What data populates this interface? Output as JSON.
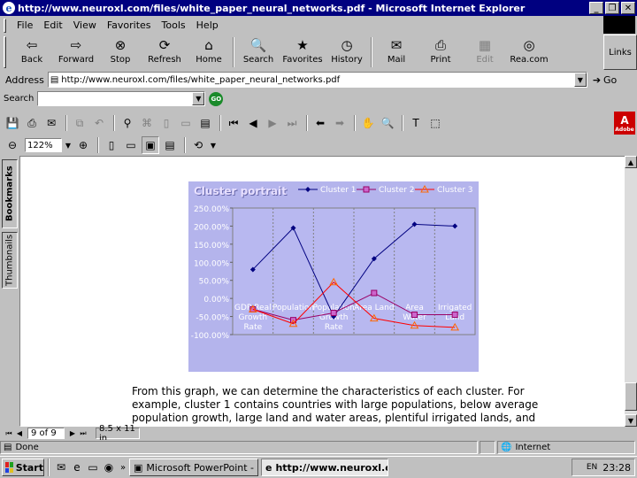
{
  "window": {
    "title": "http://www.neuroxl.com/files/white_paper_neural_networks.pdf - Microsoft Internet Explorer"
  },
  "menu": [
    "File",
    "Edit",
    "View",
    "Favorites",
    "Tools",
    "Help"
  ],
  "toolbar": {
    "back": "Back",
    "forward": "Forward",
    "stop": "Stop",
    "refresh": "Refresh",
    "home": "Home",
    "search": "Search",
    "favorites": "Favorites",
    "history": "History",
    "mail": "Mail",
    "print": "Print",
    "edit": "Edit",
    "realcom": "Rea.com",
    "links": "Links"
  },
  "address": {
    "label": "Address",
    "url": "http://www.neuroxl.com/files/white_paper_neural_networks.pdf",
    "go": "Go"
  },
  "searchbar": {
    "label": "Search",
    "go_icon": "GO"
  },
  "acrobat": {
    "zoom": "122%",
    "logo": "Adobe"
  },
  "nav_tabs": {
    "bookmarks": "Bookmarks",
    "thumbnails": "Thumbnails"
  },
  "pdf": {
    "body_text": "From this graph, we can determine the characteristics of each cluster. For example, cluster 1 contains countries with large populations, below average population growth, large land and water areas, plentiful irrigated lands, and"
  },
  "chart_data": {
    "type": "line",
    "title": "Cluster portrait",
    "categories": [
      "GDP Real Growth Rate",
      "Population",
      "Population Growth Rate",
      "Area Land",
      "Area Water",
      "Irrigated Land"
    ],
    "category_labels": [
      [
        "GDP Real",
        "Growth",
        "Rate"
      ],
      [
        "Population"
      ],
      [
        "Population",
        "Growth",
        "Rate"
      ],
      [
        "Area Land"
      ],
      [
        "Area",
        "Water"
      ],
      [
        "Irrigated",
        "Land"
      ]
    ],
    "series": [
      {
        "name": "Cluster 1",
        "color": "#000080",
        "marker": "diamond",
        "values": [
          80,
          195,
          -50,
          110,
          205,
          200
        ]
      },
      {
        "name": "Cluster 2",
        "color": "#990066",
        "marker": "square",
        "values": [
          -30,
          -60,
          -40,
          15,
          -45,
          -45
        ]
      },
      {
        "name": "Cluster 3",
        "color": "#ff0000",
        "marker": "triangle",
        "values": [
          -30,
          -70,
          45,
          -55,
          -75,
          -80
        ]
      }
    ],
    "ylim": [
      -100,
      250
    ],
    "yticks": [
      "250.00%",
      "200.00%",
      "150.00%",
      "100.00%",
      "50.00%",
      "0.00%",
      "-50.00%",
      "-100.00%"
    ],
    "legend_position": "top",
    "grid": true
  },
  "status_nav": {
    "page": "9 of 9",
    "page_size": "8.5 x 11 in"
  },
  "ie_status": {
    "done": "Done",
    "zone": "Internet"
  },
  "taskbar": {
    "start": "Start",
    "tasks": [
      "Microsoft PowerPoint - [A]",
      "http://www.neuroxl.c..."
    ],
    "clock": "23:28"
  }
}
